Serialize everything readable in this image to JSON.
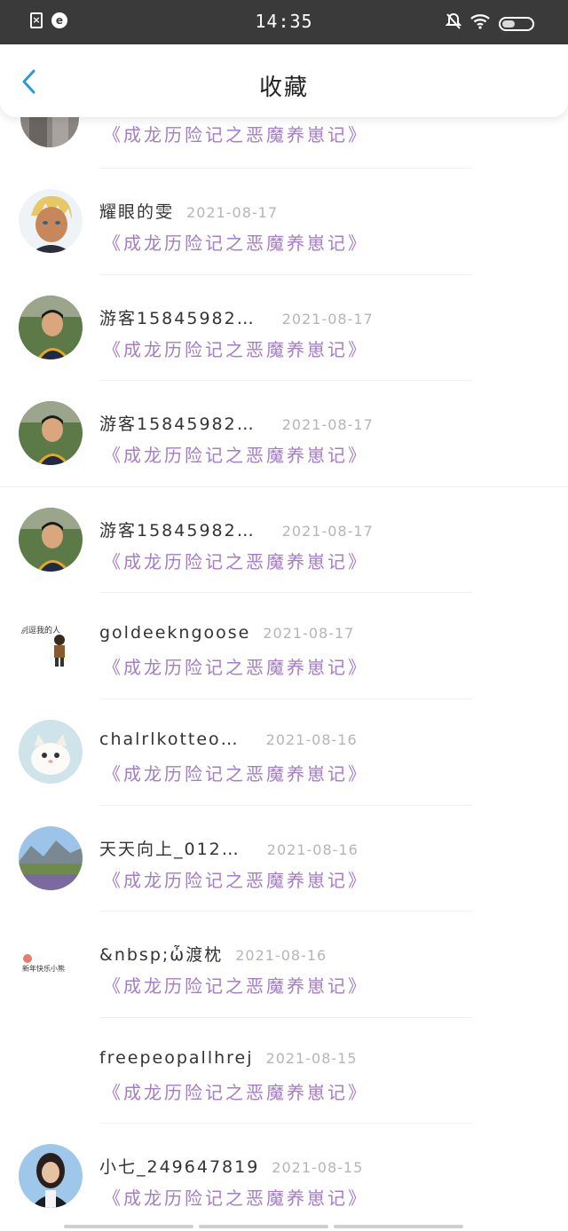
{
  "status_bar": {
    "time": "14:35",
    "left_icons": [
      "sim-off-icon",
      "notification-circle-icon"
    ],
    "right_icons": [
      "bell-off-icon",
      "wifi-icon",
      "battery-icon"
    ],
    "battery_level": 0.4
  },
  "header": {
    "back_icon": "chevron-left-icon",
    "title": "收藏",
    "accent_color": "#2a97e0"
  },
  "list": {
    "partial_item": {
      "title": "《成龙历险记之恶魔养崽记》"
    },
    "items": [
      {
        "name": "耀眼的雯",
        "date": "2021-08-17",
        "title": "《成龙历险记之恶魔养崽记》",
        "avatar": "anime-boy-avatar"
      },
      {
        "name": "游客15845982…",
        "date": "2021-08-17",
        "title": "《成龙历险记之恶魔养崽记》",
        "avatar": "boy-photo-avatar"
      },
      {
        "name": "游客15845982…",
        "date": "2021-08-17",
        "title": "《成龙历险记之恶魔养崽记》",
        "avatar": "boy-photo-avatar"
      },
      {
        "name": "游客15845982…",
        "date": "2021-08-17",
        "title": "《成龙历险记之恶魔养崽记》",
        "avatar": "boy-photo-avatar"
      },
      {
        "name": "goldeekngoose",
        "date": "2021-08-17",
        "title": "《成龙历险记之恶魔养崽记》",
        "avatar": "cartoon-figure-avatar"
      },
      {
        "name": "chalrlkotteo…",
        "date": "2021-08-16",
        "title": "《成龙历险记之恶魔养崽记》",
        "avatar": "kitten-avatar"
      },
      {
        "name": "天天向上_012…",
        "date": "2021-08-16",
        "title": "《成龙历险记之恶魔养崽记》",
        "avatar": "landscape-avatar"
      },
      {
        "name": "&nbsp;ὦ渡枕",
        "date": "2021-08-16",
        "title": "《成龙历险记之恶魔养崽记》",
        "avatar": "sticker-avatar"
      },
      {
        "name": "freepeopallhrej",
        "date": "2021-08-15",
        "title": "《成龙历险记之恶魔养崽记》",
        "avatar": "blank-avatar"
      },
      {
        "name": "小七_249647819",
        "date": "2021-08-15",
        "title": "《成龙历险记之恶魔养崽记》",
        "avatar": "girl-photo-avatar"
      }
    ]
  },
  "colors": {
    "title_purple": "#a57cc8",
    "date_gray": "#b5b5b5",
    "status_bar_bg": "#3a3a3a"
  }
}
